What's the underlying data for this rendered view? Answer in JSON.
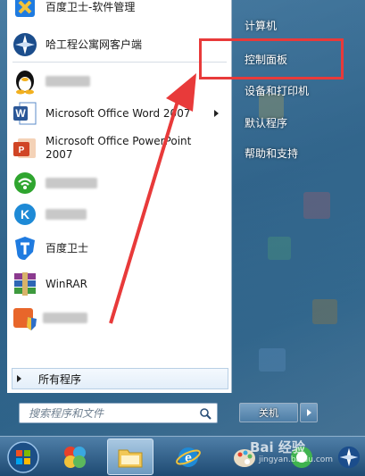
{
  "start_menu": {
    "pinned": [
      {
        "label": "百度卫士-软件管理",
        "icon": "baidu-guard-shield-icon"
      },
      {
        "label": "哈工程公寓网客户端",
        "icon": "client-compass-icon"
      }
    ],
    "recent": [
      {
        "label": "",
        "blurred": true,
        "icon": "qq-penguin-icon"
      },
      {
        "label": "Microsoft Office Word 2007",
        "has_submenu": true,
        "icon": "word-icon"
      },
      {
        "label": "Microsoft Office PowerPoint 2007",
        "icon": "powerpoint-icon"
      },
      {
        "label": "",
        "blurred": true,
        "icon": "wifi-icon"
      },
      {
        "label": "",
        "blurred": true,
        "icon": "k-app-icon"
      },
      {
        "label": "百度卫士",
        "icon": "baidu-guard-icon"
      },
      {
        "label": "WinRAR",
        "icon": "winrar-icon"
      },
      {
        "label": "",
        "blurred": true,
        "icon": "installer-shield-icon"
      }
    ],
    "all_programs_label": "所有程序",
    "search_placeholder": "搜索程序和文件",
    "right_links": [
      "计算机",
      "控制面板",
      "设备和打印机",
      "默认程序",
      "帮助和支持"
    ],
    "shutdown_label": "关机"
  },
  "watermark": {
    "brand": "Bai 经验",
    "sub": "jingyan.baidu.com"
  },
  "colors": {
    "highlight": "#e83a3a",
    "arrow": "#e83a3a",
    "menu_bg": "#ffffff"
  }
}
